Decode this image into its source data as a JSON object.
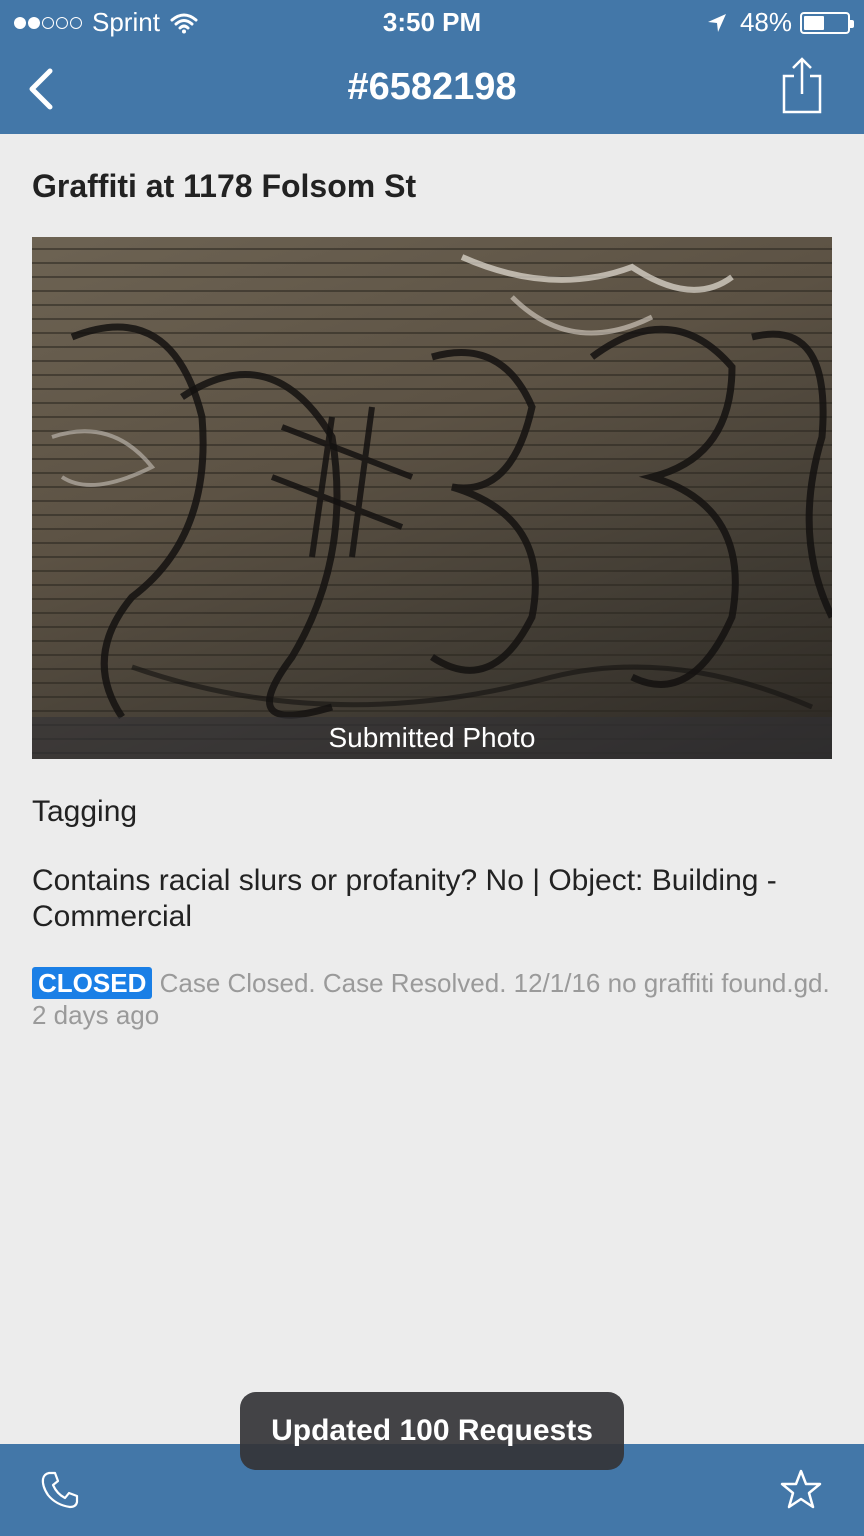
{
  "status_bar": {
    "carrier": "Sprint",
    "time": "3:50 PM",
    "battery": "48%",
    "battery_level": 0.48
  },
  "nav": {
    "title": "#6582198",
    "back_icon": "chevron-left-icon",
    "share_icon": "share-icon"
  },
  "request": {
    "title": "Graffiti at 1178 Folsom St",
    "photo_caption": "Submitted Photo",
    "category": "Tagging",
    "description": "Contains racial slurs or profanity? No | Object: Building - Commercial",
    "status_badge": "CLOSED",
    "status_text": "Case Closed. Case Resolved. 12/1/16 no graffiti found.gd. 2 days ago"
  },
  "toast": {
    "message": "Updated 100 Requests"
  },
  "bottom_bar": {
    "call_icon": "phone-icon",
    "favorite_icon": "star-icon"
  },
  "colors": {
    "bar": "#4377a8",
    "badge": "#1a7fe6",
    "background": "#ececec"
  }
}
